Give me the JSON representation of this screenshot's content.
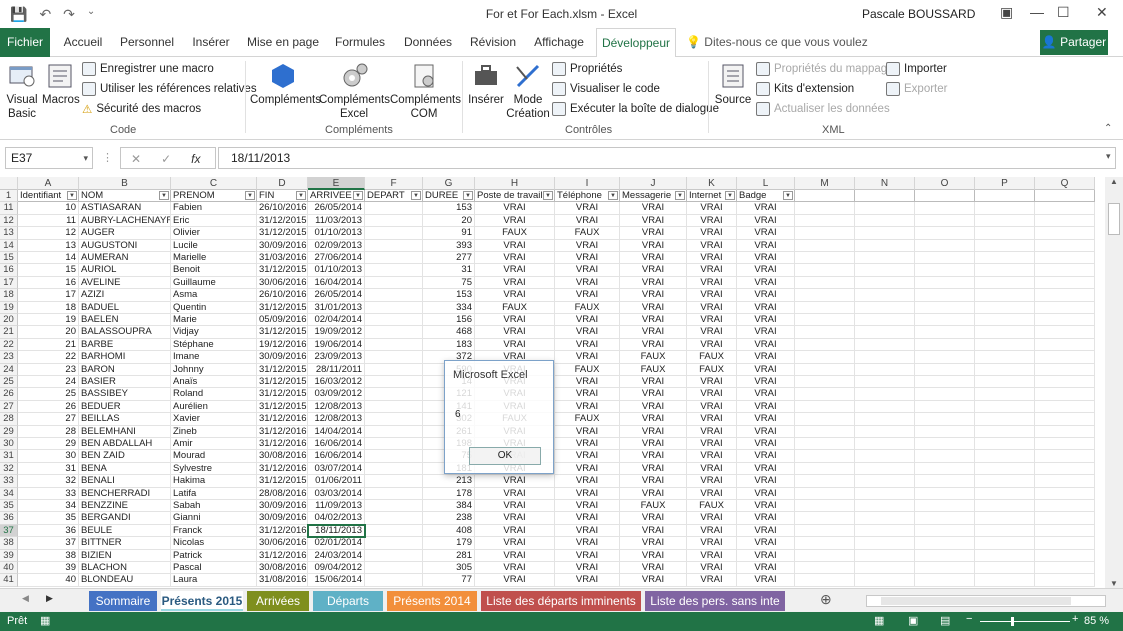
{
  "window": {
    "title": "For et For Each.xlsm  -  Excel",
    "user": "Pascale BOUSSARD"
  },
  "tabs": [
    "Fichier",
    "Accueil",
    "Personnel",
    "Insérer",
    "Mise en page",
    "Formules",
    "Données",
    "Révision",
    "Affichage",
    "Développeur"
  ],
  "tell_me": "Dites-nous ce que vous voulez faire",
  "share": "Partager",
  "ribbon": {
    "code": {
      "vb": "Visual Basic",
      "macros": "Macros",
      "record": "Enregistrer une macro",
      "relative": "Utiliser les références relatives",
      "security": "Sécurité des macros",
      "group": "Code"
    },
    "addins": {
      "comp": "Compléments",
      "excel": "Compléments Excel",
      "com": "Compléments COM",
      "group": "Compléments"
    },
    "controls": {
      "insert": "Insérer",
      "design": "Mode Création",
      "props": "Propriétés",
      "view": "Visualiser le code",
      "run": "Exécuter la boîte de dialogue",
      "group": "Contrôles"
    },
    "xml": {
      "source": "Source",
      "map": "Propriétés du mappage",
      "kits": "Kits d'extension",
      "refresh": "Actualiser les données",
      "import": "Importer",
      "export": "Exporter",
      "group": "XML"
    }
  },
  "namebox": "E37",
  "formula": "18/11/2013",
  "columns": [
    "A",
    "B",
    "C",
    "D",
    "E",
    "F",
    "G",
    "H",
    "I",
    "J",
    "K",
    "L",
    "M",
    "N",
    "O",
    "P",
    "Q"
  ],
  "headers": [
    "Identifiant",
    "NOM",
    "PRENOM",
    "FIN",
    "ARRIVEE",
    "DEPART",
    "DUREE",
    "Poste de travail",
    "Téléphone",
    "Messagerie",
    "Internet",
    "Badge"
  ],
  "rows": [
    [
      "11",
      "10",
      "ASTIASARAN",
      "Fabien",
      "26/10/2016",
      "26/05/2014",
      "",
      "153",
      "VRAI",
      "VRAI",
      "VRAI",
      "VRAI",
      "VRAI"
    ],
    [
      "12",
      "11",
      "AUBRY-LACHENAYRE",
      "Eric",
      "31/12/2015",
      "11/03/2013",
      "",
      "20",
      "VRAI",
      "VRAI",
      "VRAI",
      "VRAI",
      "VRAI"
    ],
    [
      "13",
      "12",
      "AUGER",
      "Olivier",
      "31/12/2015",
      "01/10/2013",
      "",
      "91",
      "FAUX",
      "FAUX",
      "VRAI",
      "VRAI",
      "VRAI"
    ],
    [
      "14",
      "13",
      "AUGUSTONI",
      "Lucile",
      "30/09/2016",
      "02/09/2013",
      "",
      "393",
      "VRAI",
      "VRAI",
      "VRAI",
      "VRAI",
      "VRAI"
    ],
    [
      "15",
      "14",
      "AUMERAN",
      "Marielle",
      "31/03/2016",
      "27/06/2014",
      "",
      "277",
      "VRAI",
      "VRAI",
      "VRAI",
      "VRAI",
      "VRAI"
    ],
    [
      "16",
      "15",
      "AURIOL",
      "Benoit",
      "31/12/2015",
      "01/10/2013",
      "",
      "31",
      "VRAI",
      "VRAI",
      "VRAI",
      "VRAI",
      "VRAI"
    ],
    [
      "17",
      "16",
      "AVELINE",
      "Guillaume",
      "30/06/2016",
      "16/04/2014",
      "",
      "75",
      "VRAI",
      "VRAI",
      "VRAI",
      "VRAI",
      "VRAI"
    ],
    [
      "18",
      "17",
      "AZIZI",
      "Asma",
      "26/10/2016",
      "26/05/2014",
      "",
      "153",
      "VRAI",
      "VRAI",
      "VRAI",
      "VRAI",
      "VRAI"
    ],
    [
      "19",
      "18",
      "BADUEL",
      "Quentin",
      "31/12/2015",
      "31/01/2013",
      "",
      "334",
      "FAUX",
      "FAUX",
      "VRAI",
      "VRAI",
      "VRAI"
    ],
    [
      "20",
      "19",
      "BAELEN",
      "Marie",
      "05/09/2016",
      "02/04/2014",
      "",
      "156",
      "VRAI",
      "VRAI",
      "VRAI",
      "VRAI",
      "VRAI"
    ],
    [
      "21",
      "20",
      "BALASSOUPRA",
      "Vidjay",
      "31/12/2015",
      "19/09/2012",
      "",
      "468",
      "VRAI",
      "VRAI",
      "VRAI",
      "VRAI",
      "VRAI"
    ],
    [
      "22",
      "21",
      "BARBE",
      "Stéphane",
      "19/12/2016",
      "19/06/2014",
      "",
      "183",
      "VRAI",
      "VRAI",
      "VRAI",
      "VRAI",
      "VRAI"
    ],
    [
      "23",
      "22",
      "BARHOMI",
      "Imane",
      "30/09/2016",
      "23/09/2013",
      "",
      "372",
      "VRAI",
      "VRAI",
      "FAUX",
      "FAUX",
      "VRAI"
    ],
    [
      "24",
      "23",
      "BARON",
      "Johnny",
      "31/12/2015",
      "28/11/2011",
      "",
      "590",
      "VRAI",
      "FAUX",
      "FAUX",
      "FAUX",
      "VRAI"
    ],
    [
      "25",
      "24",
      "BASIER",
      "Anaïs",
      "31/12/2015",
      "16/03/2012",
      "",
      "14",
      "VRAI",
      "VRAI",
      "VRAI",
      "VRAI",
      "VRAI"
    ],
    [
      "26",
      "25",
      "BASSIBEY",
      "Roland",
      "31/12/2015",
      "03/09/2012",
      "",
      "121",
      "VRAI",
      "VRAI",
      "VRAI",
      "VRAI",
      "VRAI"
    ],
    [
      "27",
      "26",
      "BEDUER",
      "Aurélien",
      "31/12/2015",
      "12/08/2013",
      "",
      "141",
      "VRAI",
      "VRAI",
      "VRAI",
      "VRAI",
      "VRAI"
    ],
    [
      "28",
      "27",
      "BEILLAS",
      "Xavier",
      "31/12/2016",
      "12/08/2013",
      "",
      "302",
      "FAUX",
      "FAUX",
      "VRAI",
      "VRAI",
      "VRAI"
    ],
    [
      "29",
      "28",
      "BELEMHANI",
      "Zineb",
      "31/12/2016",
      "14/04/2014",
      "",
      "261",
      "VRAI",
      "VRAI",
      "VRAI",
      "VRAI",
      "VRAI"
    ],
    [
      "30",
      "29",
      "BEN ABDALLAH",
      "Amir",
      "31/12/2016",
      "16/06/2014",
      "",
      "198",
      "VRAI",
      "VRAI",
      "VRAI",
      "VRAI",
      "VRAI"
    ],
    [
      "31",
      "30",
      "BEN ZAID",
      "Mourad",
      "30/08/2016",
      "16/06/2014",
      "",
      "75",
      "VRAI",
      "VRAI",
      "VRAI",
      "VRAI",
      "VRAI"
    ],
    [
      "32",
      "31",
      "BENA",
      "Sylvestre",
      "31/12/2016",
      "03/07/2014",
      "",
      "181",
      "VRAI",
      "VRAI",
      "VRAI",
      "VRAI",
      "VRAI"
    ],
    [
      "33",
      "32",
      "BENALI",
      "Hakima",
      "31/12/2015",
      "01/06/2011",
      "",
      "213",
      "VRAI",
      "VRAI",
      "VRAI",
      "VRAI",
      "VRAI"
    ],
    [
      "34",
      "33",
      "BENCHERRADI",
      "Latifa",
      "28/08/2016",
      "03/03/2014",
      "",
      "178",
      "VRAI",
      "VRAI",
      "VRAI",
      "VRAI",
      "VRAI"
    ],
    [
      "35",
      "34",
      "BENZZINE",
      "Sabah",
      "30/09/2016",
      "11/09/2013",
      "",
      "384",
      "VRAI",
      "VRAI",
      "FAUX",
      "FAUX",
      "VRAI"
    ],
    [
      "36",
      "35",
      "BERGANDI",
      "Gianni",
      "30/09/2016",
      "04/02/2013",
      "",
      "238",
      "VRAI",
      "VRAI",
      "VRAI",
      "VRAI",
      "VRAI"
    ],
    [
      "37",
      "36",
      "BEULE",
      "Franck",
      "31/12/2016",
      "18/11/2013",
      "",
      "408",
      "VRAI",
      "VRAI",
      "VRAI",
      "VRAI",
      "VRAI"
    ],
    [
      "38",
      "37",
      "BITTNER",
      "Nicolas",
      "30/06/2016",
      "02/01/2014",
      "",
      "179",
      "VRAI",
      "VRAI",
      "VRAI",
      "VRAI",
      "VRAI"
    ],
    [
      "39",
      "38",
      "BIZIEN",
      "Patrick",
      "31/12/2016",
      "24/03/2014",
      "",
      "281",
      "VRAI",
      "VRAI",
      "VRAI",
      "VRAI",
      "VRAI"
    ],
    [
      "40",
      "39",
      "BLACHON",
      "Pascal",
      "30/08/2016",
      "09/04/2012",
      "",
      "305",
      "VRAI",
      "VRAI",
      "VRAI",
      "VRAI",
      "VRAI"
    ],
    [
      "41",
      "40",
      "BLONDEAU",
      "Laura",
      "31/08/2016",
      "15/06/2014",
      "",
      "77",
      "VRAI",
      "VRAI",
      "VRAI",
      "VRAI",
      "VRAI"
    ]
  ],
  "msgbox": {
    "title": "Microsoft Excel",
    "value": "6",
    "ok": "OK"
  },
  "sheets": [
    {
      "name": "Sommaire",
      "color": "#4472c4"
    },
    {
      "name": "Présents 2015",
      "color": "#9bd7e3"
    },
    {
      "name": "Arrivées",
      "color": "#7f8f1e"
    },
    {
      "name": "Départs",
      "color": "#5fb1c6"
    },
    {
      "name": "Présents 2014",
      "color": "#f28f3b"
    },
    {
      "name": "Liste des départs imminents",
      "color": "#c0504d"
    },
    {
      "name": "Liste des pers. sans inte",
      "color": "#8064a2"
    }
  ],
  "status": {
    "ready": "Prêt",
    "zoom": "85 %"
  }
}
